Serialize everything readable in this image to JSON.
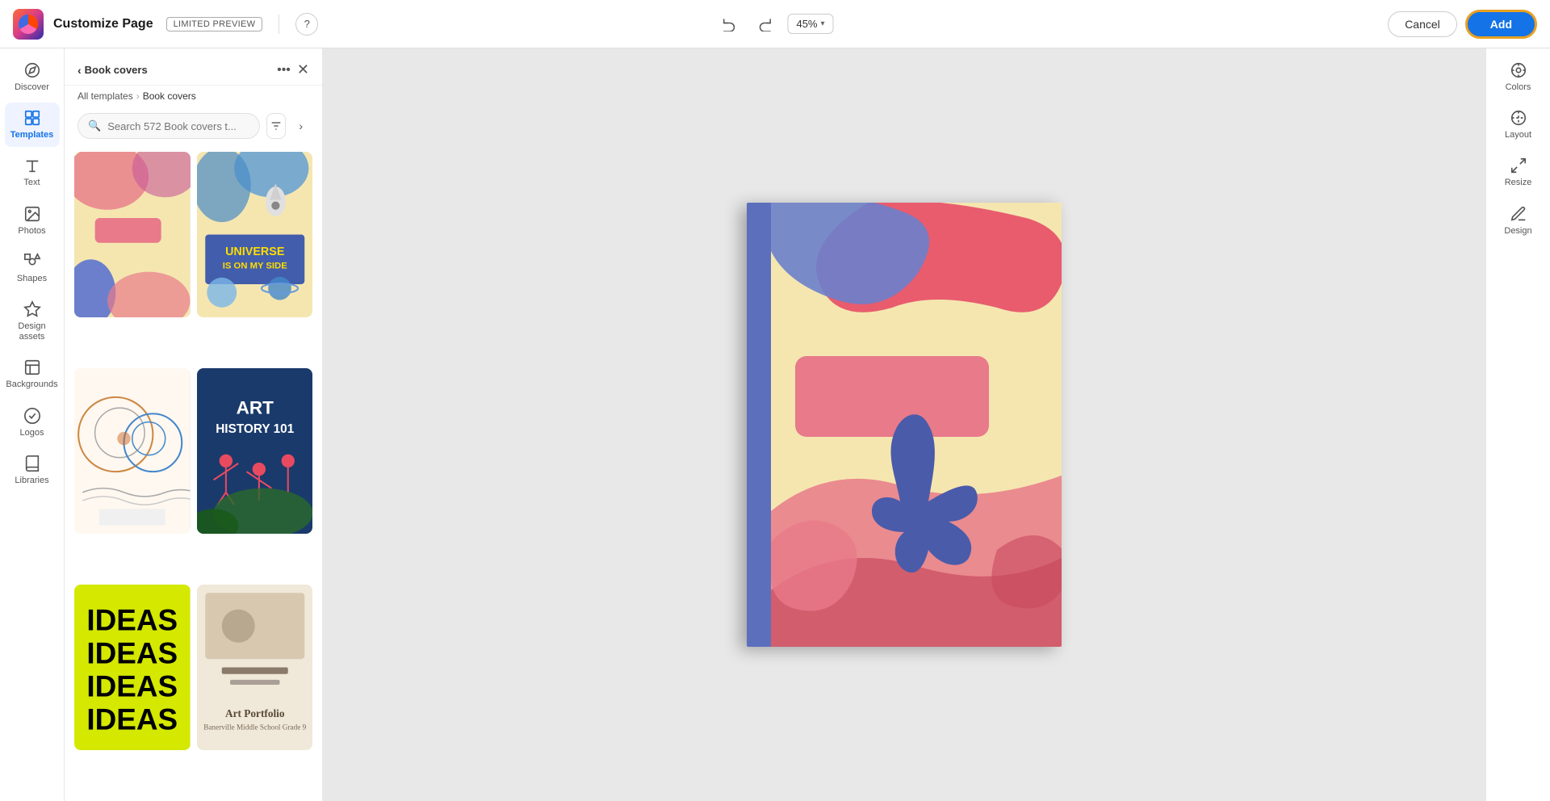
{
  "app": {
    "logo_alt": "Adobe app logo",
    "title": "Customize Page",
    "preview_badge": "LIMITED PREVIEW",
    "help_tooltip": "Help"
  },
  "toolbar": {
    "undo_label": "↺",
    "redo_label": "↻",
    "zoom_value": "45%",
    "cancel_label": "Cancel",
    "add_label": "Add"
  },
  "panel": {
    "back_label": "Book covers",
    "more_label": "•••",
    "close_label": "✕",
    "breadcrumb_parent": "All templates",
    "breadcrumb_sep": "›",
    "breadcrumb_current": "Book covers",
    "search_placeholder": "Search 572 Book covers t...",
    "search_count": "572",
    "templates": [
      {
        "id": 1,
        "alt": "Floral book cover warm"
      },
      {
        "id": 2,
        "alt": "Universe is on my side book cover"
      },
      {
        "id": 3,
        "alt": "Abstract circles book cover"
      },
      {
        "id": 4,
        "alt": "Art History 101 book cover"
      },
      {
        "id": 5,
        "alt": "Ideas book cover yellow-green"
      },
      {
        "id": 6,
        "alt": "Art Portfolio book cover"
      }
    ]
  },
  "left_sidebar": {
    "items": [
      {
        "id": "discover",
        "label": "Discover",
        "icon": "compass"
      },
      {
        "id": "templates",
        "label": "Templates",
        "icon": "templates",
        "active": true
      },
      {
        "id": "text",
        "label": "Text",
        "icon": "text"
      },
      {
        "id": "photos",
        "label": "Photos",
        "icon": "photos"
      },
      {
        "id": "shapes",
        "label": "Shapes",
        "icon": "shapes"
      },
      {
        "id": "design-assets",
        "label": "Design assets",
        "icon": "design-assets"
      },
      {
        "id": "backgrounds",
        "label": "Backgrounds",
        "icon": "backgrounds"
      },
      {
        "id": "logos",
        "label": "Logos",
        "icon": "logos"
      },
      {
        "id": "libraries",
        "label": "Libraries",
        "icon": "libraries"
      }
    ]
  },
  "right_sidebar": {
    "items": [
      {
        "id": "colors",
        "label": "Colors",
        "icon": "colors"
      },
      {
        "id": "layout",
        "label": "Layout",
        "icon": "layout"
      },
      {
        "id": "resize",
        "label": "Resize",
        "icon": "resize"
      },
      {
        "id": "design",
        "label": "Design",
        "icon": "design"
      }
    ]
  }
}
